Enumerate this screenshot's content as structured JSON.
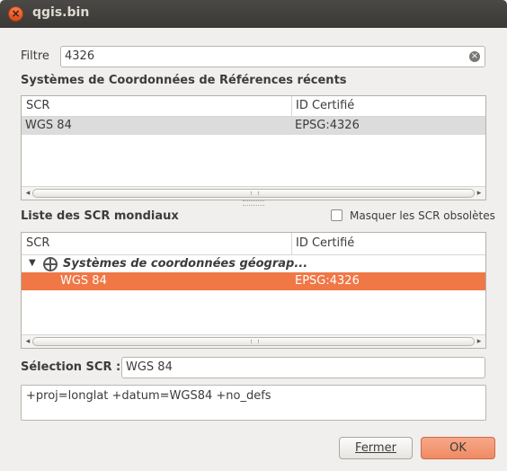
{
  "window": {
    "title": "qgis.bin"
  },
  "filter": {
    "label": "Filtre",
    "value": "4326"
  },
  "recent": {
    "heading": "Systèmes de Coordonnées de Références récents",
    "columns": [
      "SCR",
      "ID Certifié"
    ],
    "rows": [
      {
        "scr": "WGS 84",
        "id": "EPSG:4326"
      }
    ]
  },
  "world": {
    "heading": "Liste des SCR mondiaux",
    "hide_deprecated_label": "Masquer les SCR obsolètes",
    "hide_deprecated_checked": false,
    "columns": [
      "SCR",
      "ID Certifié"
    ],
    "group": "Systèmes de coordonnées géograp...",
    "rows": [
      {
        "scr": "WGS 84",
        "id": "EPSG:4326"
      }
    ]
  },
  "selection": {
    "label": "Sélection SCR :",
    "value": "WGS 84"
  },
  "proj_string": "+proj=longlat +datum=WGS84 +no_defs",
  "buttons": {
    "cancel": "Fermer",
    "ok": "OK"
  },
  "colors": {
    "accent": "#f07746",
    "selected_row_recent": "#dcdcdc"
  }
}
